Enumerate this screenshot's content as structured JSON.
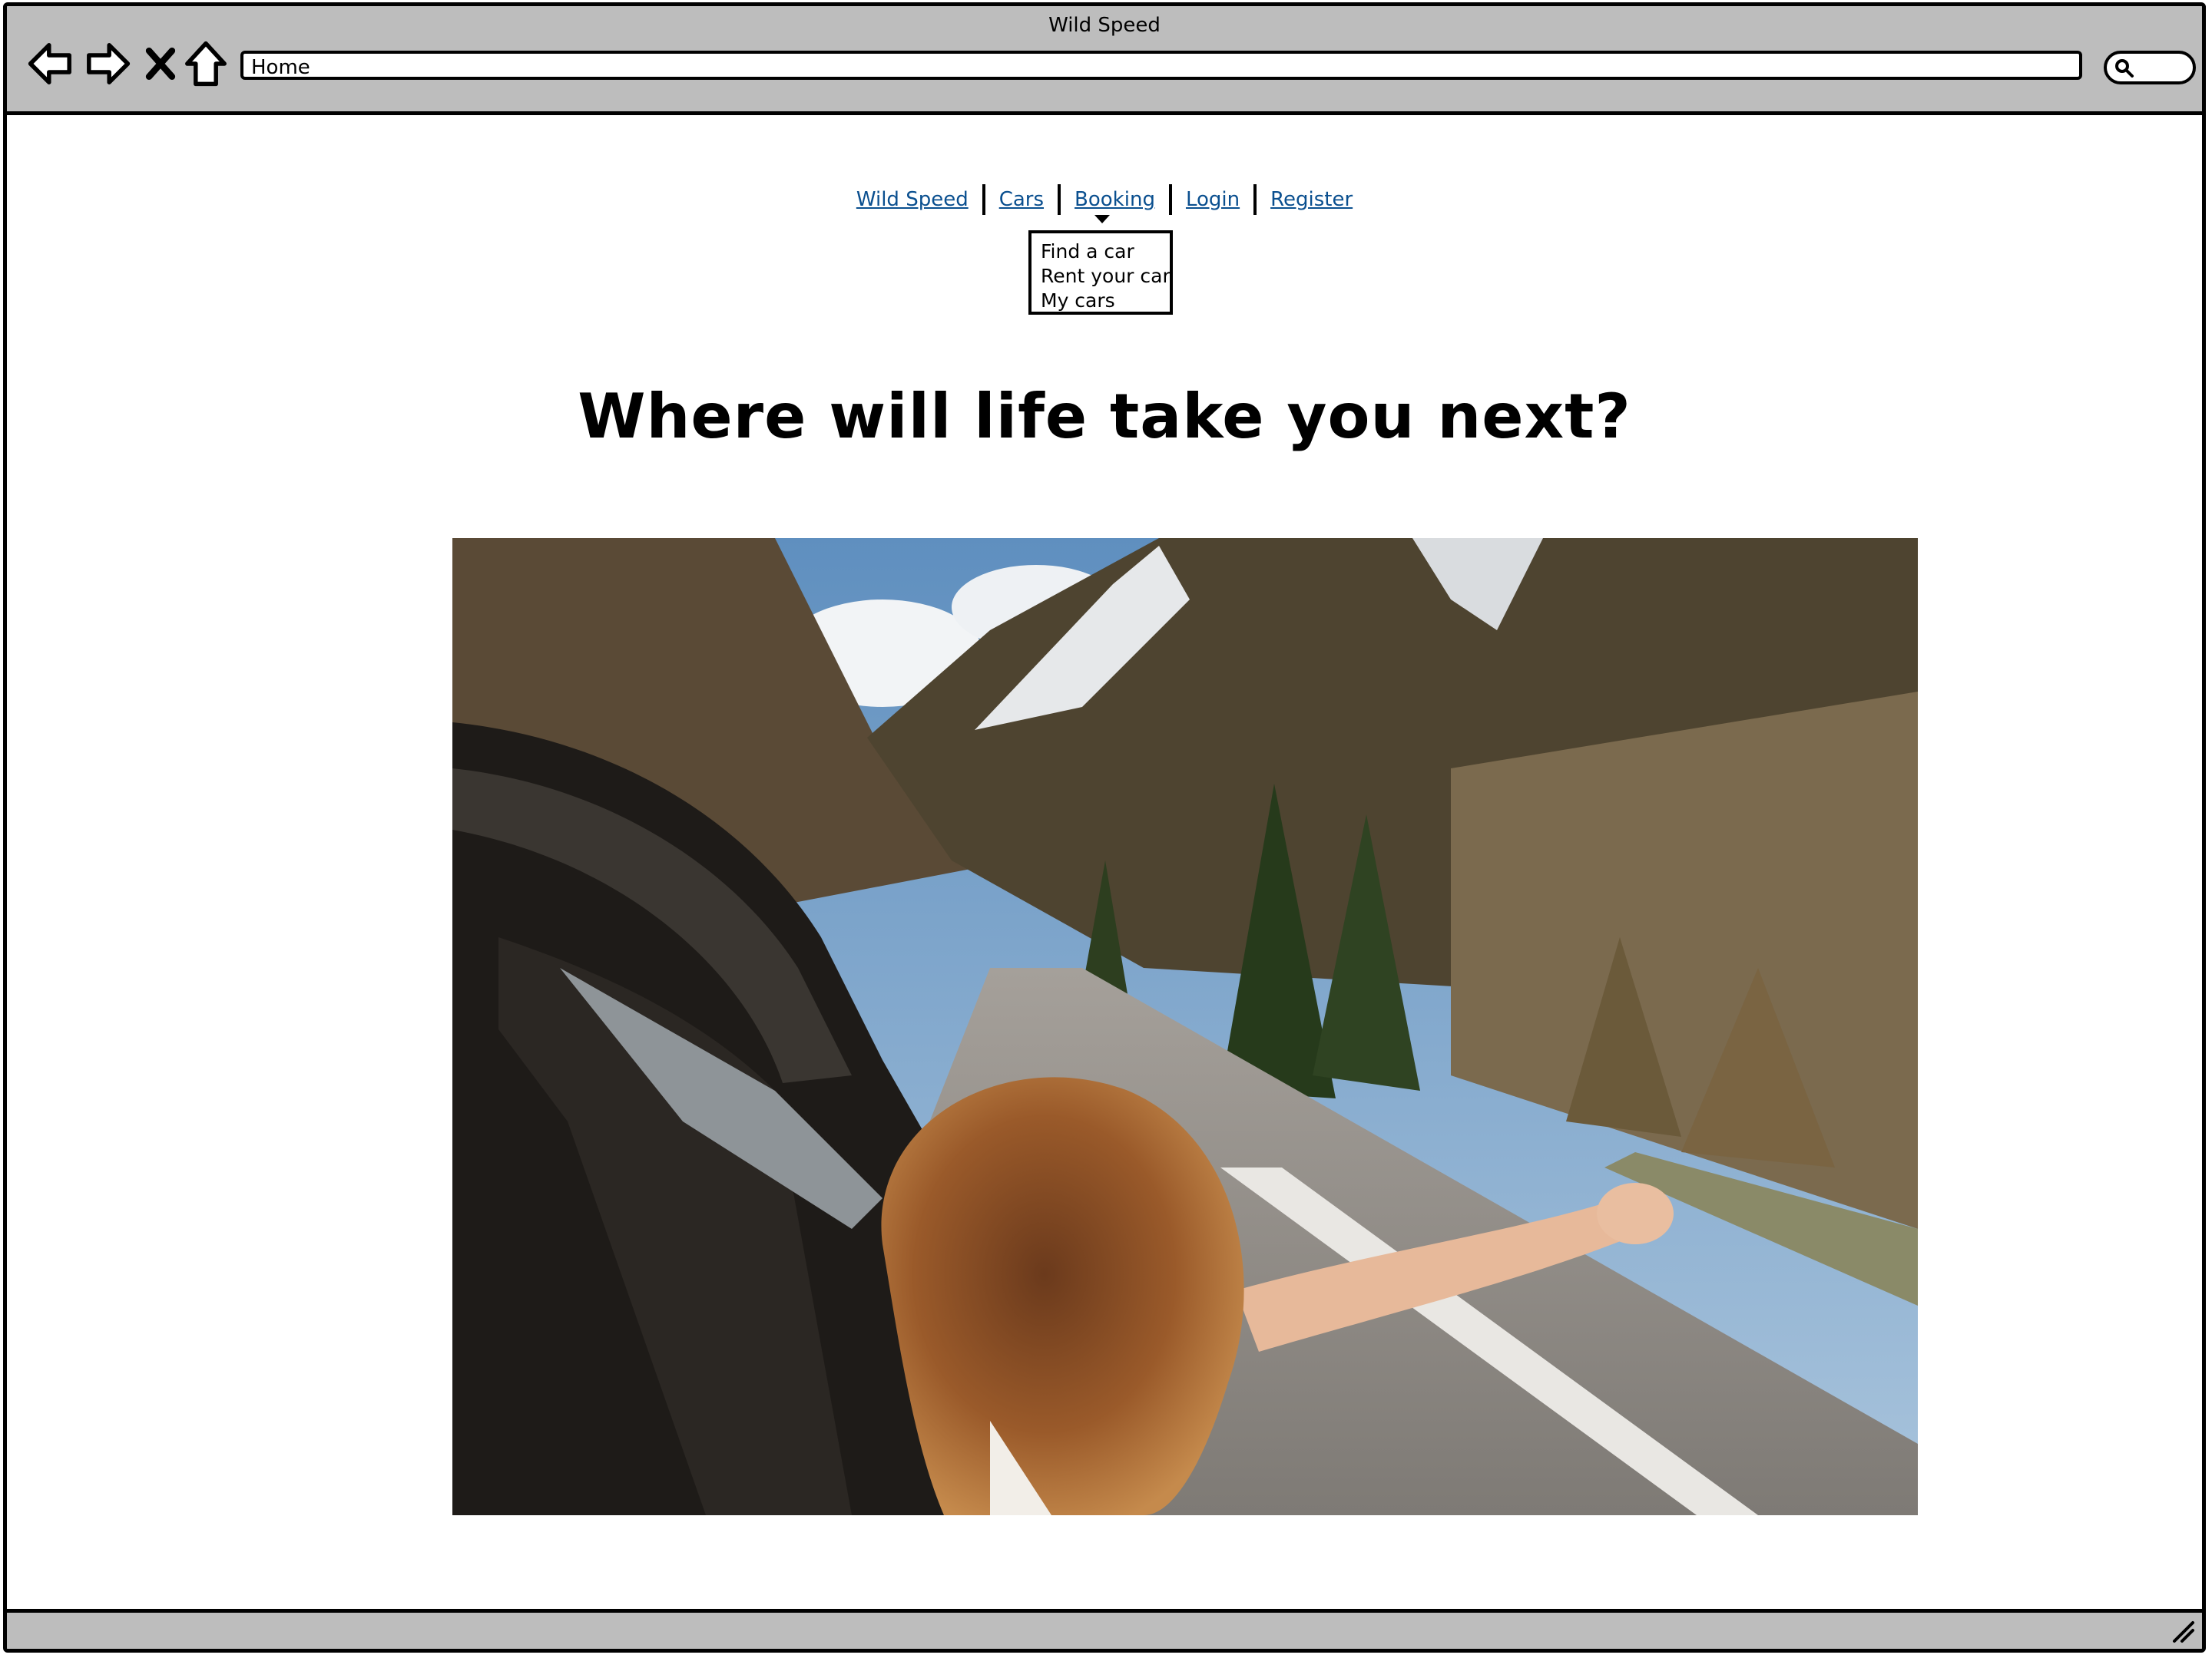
{
  "browser": {
    "window_title": "Wild Speed",
    "address_value": "Home"
  },
  "nav": {
    "items": [
      {
        "label": "Wild Speed"
      },
      {
        "label": "Cars"
      },
      {
        "label": "Booking"
      },
      {
        "label": "Login"
      },
      {
        "label": "Register"
      }
    ],
    "cars_dropdown": [
      "Find a car",
      "Rent your car",
      "My cars"
    ]
  },
  "main": {
    "headline": "Where will life take you next?"
  },
  "hero_image": {
    "icon": "photo-woman-leaning-out-car-window-mountain-road"
  },
  "colors": {
    "chrome": "#bdbdbd",
    "link": "#0a4f8f"
  }
}
